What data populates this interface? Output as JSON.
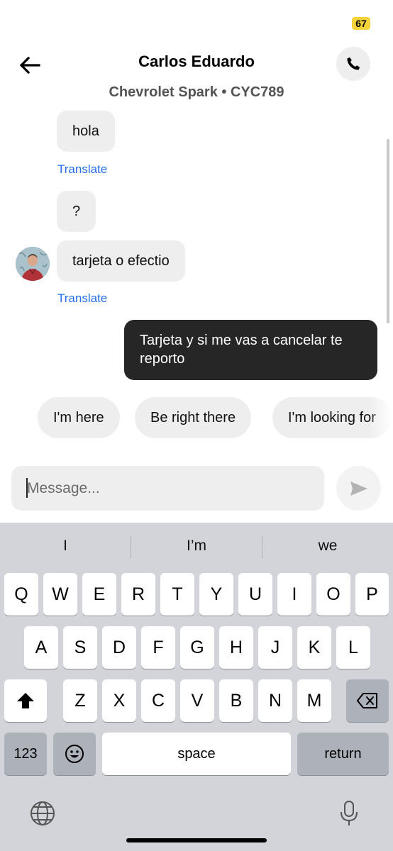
{
  "status": {
    "battery": "67"
  },
  "header": {
    "title": "Carlos Eduardo",
    "subtitle": "Chevrolet Spark • CYC789"
  },
  "messages": [
    {
      "direction": "in",
      "text": "hola",
      "translate": "Translate"
    },
    {
      "direction": "in",
      "text": "?"
    },
    {
      "direction": "in",
      "text": "tarjeta o efectio",
      "translate": "Translate"
    },
    {
      "direction": "out",
      "text": "Tarjeta y si me vas a cancelar te reporto"
    }
  ],
  "quick_replies": [
    "I'm here",
    "Be right there",
    "I'm looking for"
  ],
  "composer": {
    "placeholder": "Message..."
  },
  "keyboard": {
    "suggestions": [
      "I",
      "I’m",
      "we"
    ],
    "row1": [
      "Q",
      "W",
      "E",
      "R",
      "T",
      "Y",
      "U",
      "I",
      "O",
      "P"
    ],
    "row2": [
      "A",
      "S",
      "D",
      "F",
      "G",
      "H",
      "J",
      "K",
      "L"
    ],
    "row3": [
      "Z",
      "X",
      "C",
      "V",
      "B",
      "N",
      "M"
    ],
    "numbers_label": "123",
    "space_label": "space",
    "return_label": "return"
  },
  "colors": {
    "accent_link": "#276ef1",
    "outgoing_bubble": "#262626",
    "incoming_bubble": "#eeeeee",
    "battery": "#f5d33a"
  },
  "icons": [
    "back-arrow-icon",
    "phone-icon",
    "send-icon",
    "shift-icon",
    "backspace-icon",
    "emoji-icon",
    "globe-icon",
    "microphone-icon"
  ]
}
